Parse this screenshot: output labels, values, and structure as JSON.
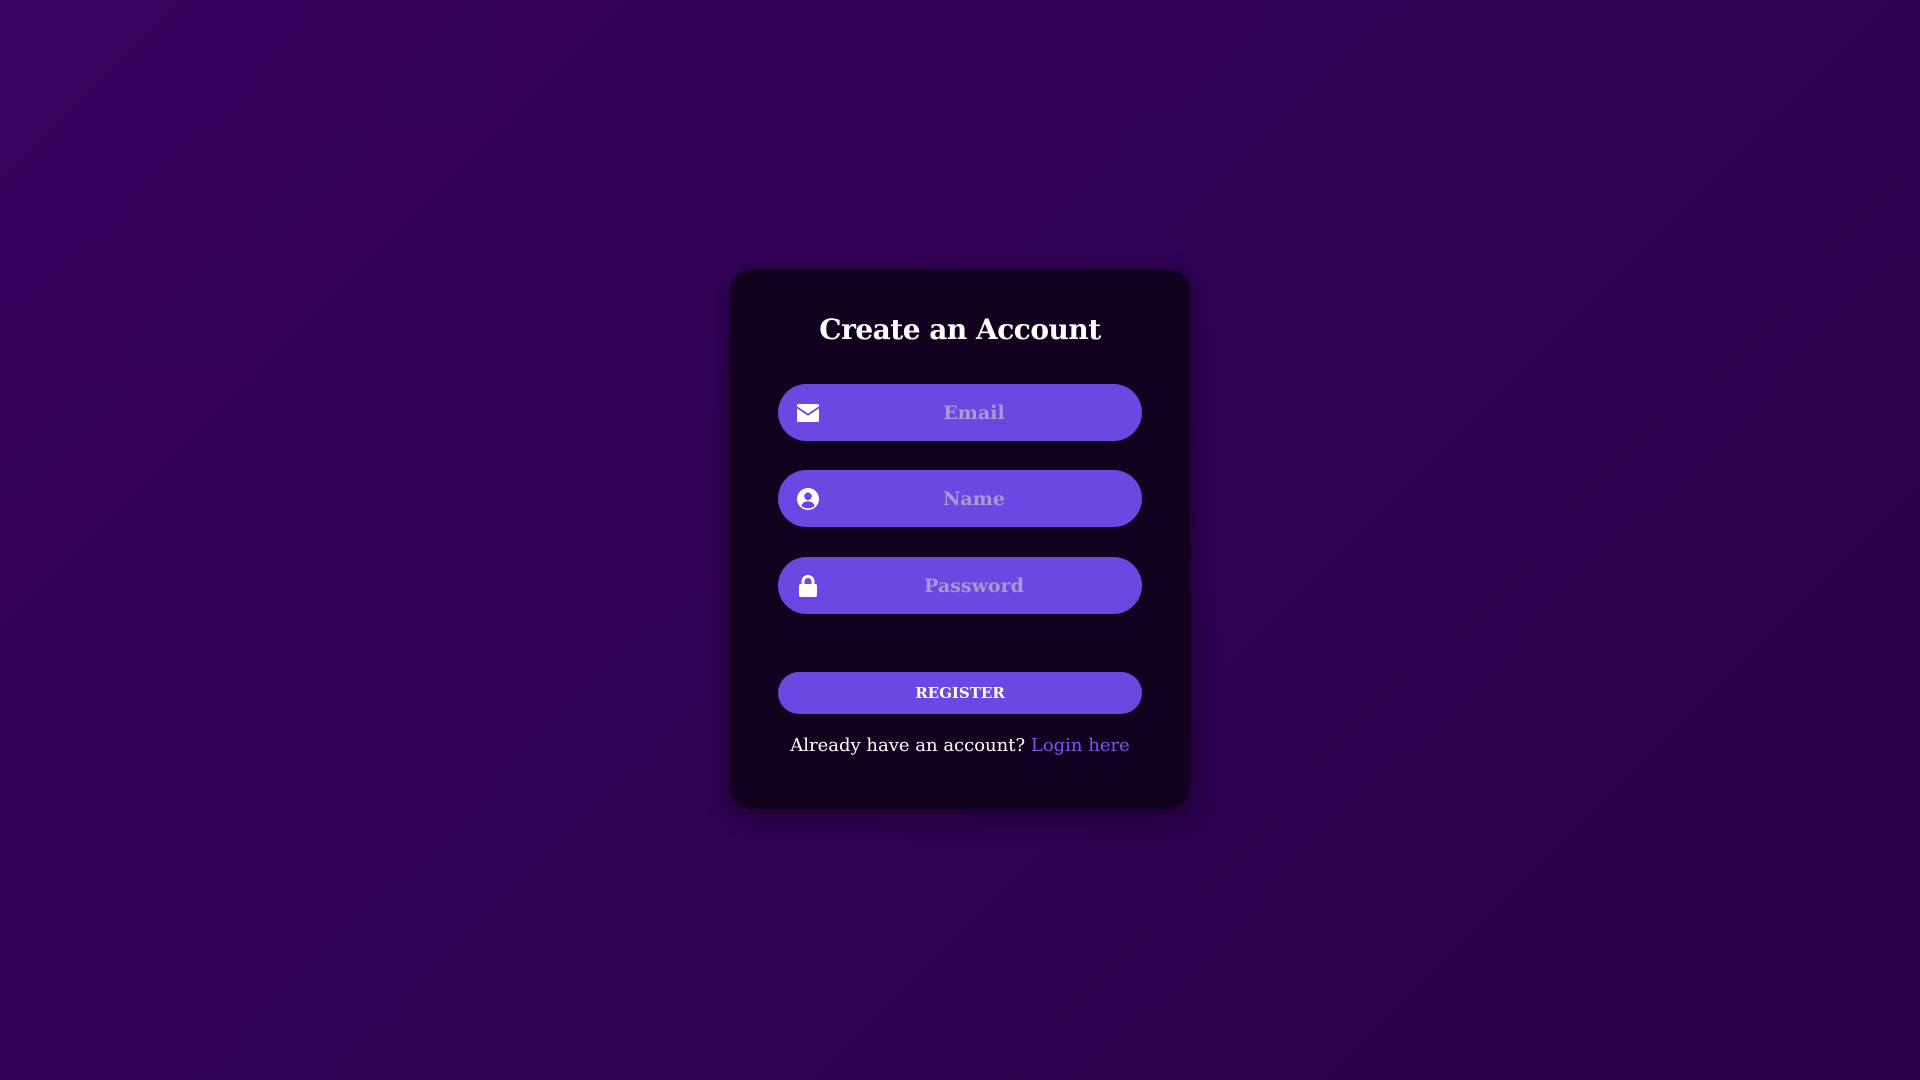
{
  "form": {
    "title": "Create an Account",
    "fields": [
      {
        "name": "email",
        "placeholder": "Email",
        "icon": "envelope-icon"
      },
      {
        "name": "name",
        "placeholder": "Name",
        "icon": "user-circle-icon"
      },
      {
        "name": "password",
        "placeholder": "Password",
        "icon": "lock-icon"
      }
    ],
    "register_label": "REGISTER",
    "login_prompt": "Already have an account?",
    "login_link": "Login here"
  },
  "colors": {
    "background": "#32025a",
    "card": "#12021f",
    "accent": "#6c47e2",
    "link": "#7a55f0",
    "placeholder": "#a89ad2"
  }
}
